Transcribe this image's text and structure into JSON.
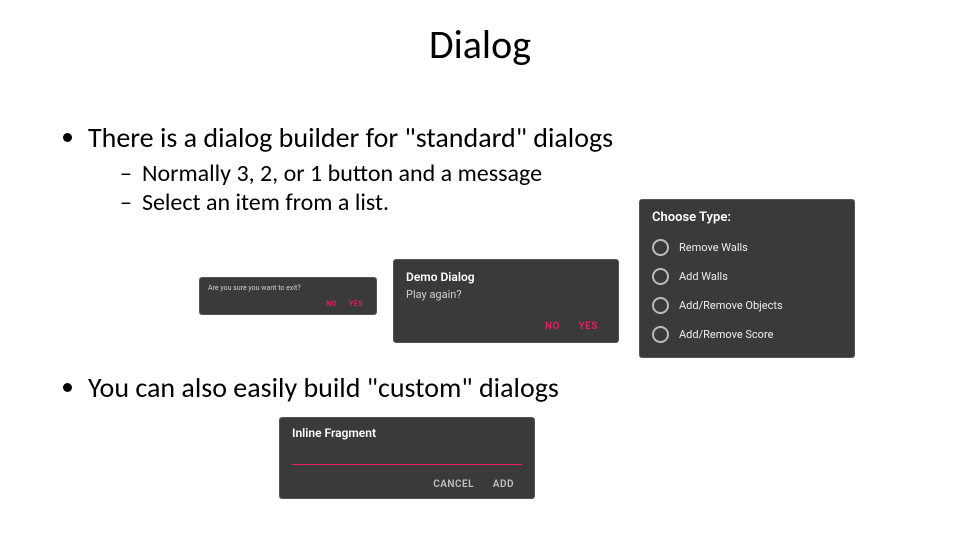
{
  "title": "Dialog",
  "bullets": {
    "b1": "There is a dialog builder for \"standard\" dialogs",
    "b1_sub1": "Normally 3, 2, or 1 button and a message",
    "b1_sub2": "Select an item from a list.",
    "b2": "You can also easily build \"custom\" dialogs"
  },
  "dialog_a": {
    "message": "Are you sure you want to exit?",
    "no": "NO",
    "yes": "YES"
  },
  "dialog_b": {
    "title": "Demo Dialog",
    "message": "Play again?",
    "no": "NO",
    "yes": "YES"
  },
  "dialog_c": {
    "title": "Choose Type:",
    "options": {
      "o0": "Remove Walls",
      "o1": "Add Walls",
      "o2": "Add/Remove Objects",
      "o3": "Add/Remove Score"
    }
  },
  "dialog_d": {
    "title": "Inline Fragment",
    "cancel": "CANCEL",
    "add": "ADD"
  }
}
